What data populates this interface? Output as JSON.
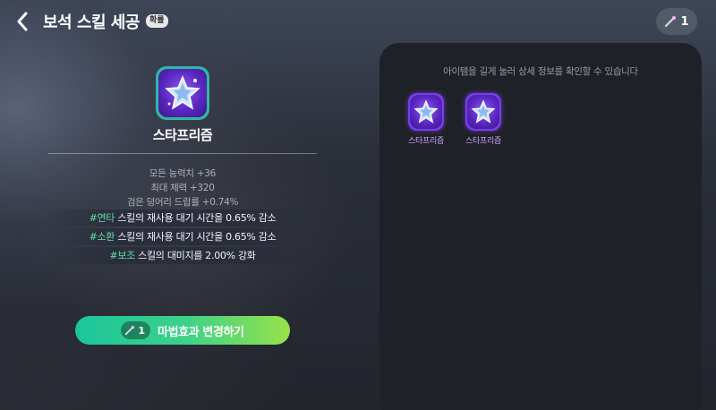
{
  "header": {
    "title": "보석 스킬 세공",
    "badge": "확률",
    "currency_count": "1",
    "back_icon": "chevron-left-icon",
    "currency_icon": "magic-wand-icon"
  },
  "skill": {
    "name": "스타프리즘",
    "icon": "star-gem-icon",
    "stats": [
      "모든 능력치 +36",
      "최대 체력 +320",
      "검은 덩어리 드랍률 +0.74%"
    ],
    "effects": [
      {
        "tag": "#연타",
        "text": " 스킬의 재사용 대기 시간을 0.65% 감소"
      },
      {
        "tag": "#소환",
        "text": " 스킬의 재사용 대기 시간을 0.65% 감소"
      },
      {
        "tag": "#보조",
        "text": " 스킬의 대미지를 2.00% 강화"
      }
    ]
  },
  "action": {
    "cost": "1",
    "label": "마법효과 변경하기"
  },
  "panel": {
    "hint": "아이템을 길게 눌러 상세 정보를 확인할 수 있습니다",
    "items": [
      {
        "name": "스타프리즘"
      },
      {
        "name": "스타프리즘"
      }
    ]
  },
  "colors": {
    "accent_green": "#1cc59a",
    "accent_lime": "#98e24a",
    "effect_tag": "#5fe0a6",
    "item_name": "#c9a6ff",
    "gem_purple": "#5a27c2"
  }
}
